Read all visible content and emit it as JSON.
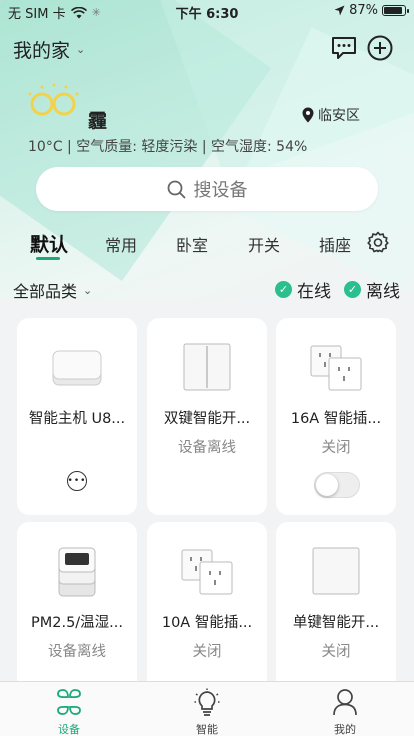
{
  "status_bar": {
    "carrier": "无 SIM 卡",
    "time": "下午 6:30",
    "battery": "87%"
  },
  "header": {
    "home_name": "我的家",
    "icons": [
      "chevron-down-icon",
      "message-icon",
      "add-icon"
    ]
  },
  "weather": {
    "condition": "霾",
    "location": "临安区",
    "details": "10°C | 空气质量: 轻度污染 | 空气湿度: 54%",
    "icon": "haze-icon"
  },
  "search": {
    "placeholder": "搜设备"
  },
  "tabs": [
    {
      "label": "默认",
      "active": true
    },
    {
      "label": "常用",
      "active": false
    },
    {
      "label": "卧室",
      "active": false
    },
    {
      "label": "开关",
      "active": false
    },
    {
      "label": "插座",
      "active": false
    }
  ],
  "filter": {
    "category": "全部品类",
    "online": "在线",
    "offline": "离线"
  },
  "devices": [
    {
      "name": "智能主机 U8...",
      "status": "",
      "control": "more",
      "icon": "hub-icon"
    },
    {
      "name": "双键智能开...",
      "status": "设备离线",
      "control": "none",
      "icon": "double-switch-icon"
    },
    {
      "name": "16A 智能插...",
      "status": "关闭",
      "control": "toggle",
      "icon": "socket-16a-icon"
    },
    {
      "name": "PM2.5/温湿...",
      "status": "设备离线",
      "control": "none",
      "icon": "air-sensor-icon"
    },
    {
      "name": "10A 智能插...",
      "status": "关闭",
      "control": "toggle",
      "icon": "socket-10a-icon"
    },
    {
      "name": "单键智能开...",
      "status": "关闭",
      "control": "toggle",
      "icon": "single-switch-icon"
    }
  ],
  "bottom_nav": [
    {
      "label": "设备",
      "active": true,
      "icon": "devices-icon"
    },
    {
      "label": "智能",
      "active": false,
      "icon": "bulb-icon"
    },
    {
      "label": "我的",
      "active": false,
      "icon": "profile-icon"
    }
  ],
  "colors": {
    "accent": "#1aa97b",
    "check": "#2bbf8e",
    "weather_icon": "#f2d24a"
  }
}
